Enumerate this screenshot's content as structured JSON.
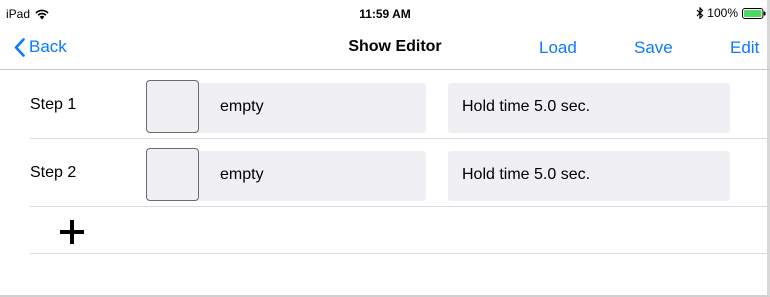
{
  "status_bar": {
    "carrier": "iPad",
    "time": "11:59 AM",
    "battery": "100%"
  },
  "nav": {
    "back_label": "Back",
    "title": "Show Editor",
    "load_label": "Load",
    "save_label": "Save",
    "edit_label": "Edit"
  },
  "steps": [
    {
      "label": "Step 1",
      "value": "empty",
      "hold": "Hold time 5.0 sec."
    },
    {
      "label": "Step 2",
      "value": "empty",
      "hold": "Hold time 5.0 sec."
    }
  ],
  "colors": {
    "accent": "#0a7aff",
    "field_bg": "#efeff4",
    "battery": "#4cd964"
  },
  "icons": [
    "wifi-icon",
    "bluetooth-icon",
    "battery-icon",
    "chevron-left-icon",
    "plus-icon"
  ]
}
